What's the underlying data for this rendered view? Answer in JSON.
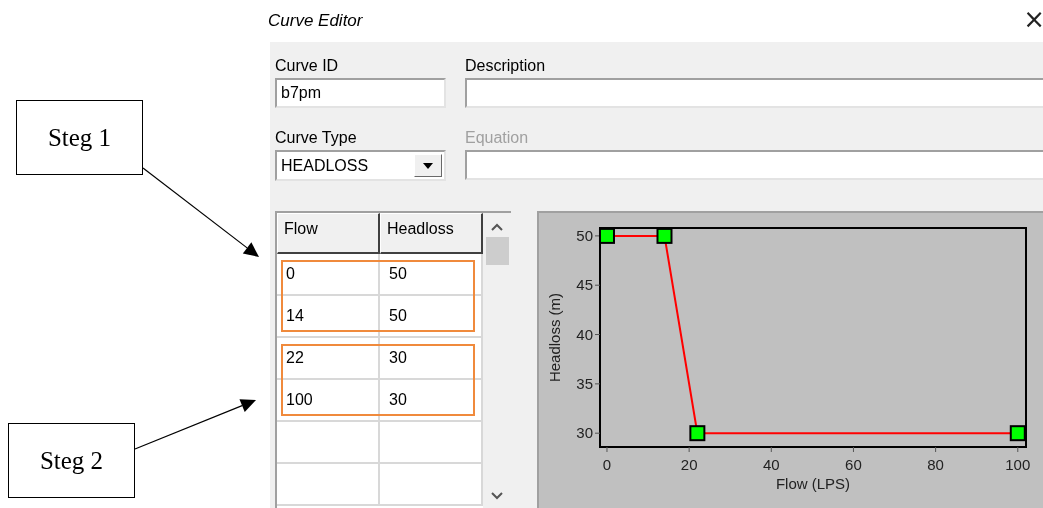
{
  "window": {
    "title": "Curve Editor",
    "close": "×"
  },
  "fields": {
    "curve_id": {
      "label": "Curve ID",
      "value": "b7pm"
    },
    "description": {
      "label": "Description"
    },
    "curve_type": {
      "label": "Curve Type",
      "value": "HEADLOSS"
    },
    "equation": {
      "label": "Equation",
      "disabled": true
    }
  },
  "table": {
    "columns": [
      "Flow",
      "Headloss"
    ],
    "rows": [
      [
        "0",
        "50"
      ],
      [
        "14",
        "50"
      ],
      [
        "22",
        "30"
      ],
      [
        "100",
        "30"
      ]
    ]
  },
  "chart": {
    "chart_data": {
      "type": "line",
      "xlabel": "Flow (LPS)",
      "ylabel": "Headloss (m)",
      "x": [
        0,
        14,
        22,
        100
      ],
      "series": [
        {
          "color": "#ff0000",
          "marker": "square",
          "values": [
            50,
            50,
            30,
            30
          ]
        }
      ],
      "xlim": [
        -1.7,
        102
      ],
      "ylim": [
        28.6,
        50.8
      ],
      "xticks": [
        0,
        20,
        40,
        60,
        80,
        100
      ],
      "yticks": [
        30,
        35,
        40,
        45,
        50
      ]
    }
  },
  "annotations": [
    {
      "label": "Steg 1"
    },
    {
      "label": "Steg 2"
    }
  ]
}
